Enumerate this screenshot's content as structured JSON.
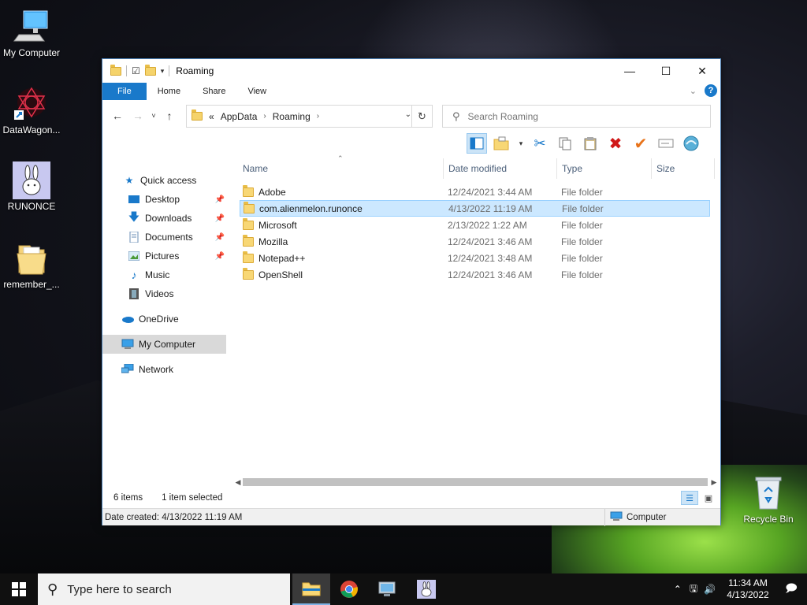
{
  "desktop": {
    "icons": [
      {
        "label": "My Computer"
      },
      {
        "label": "DataWagon..."
      },
      {
        "label": "RUNONCE"
      },
      {
        "label": "remember_..."
      },
      {
        "label": "Recycle Bin"
      }
    ]
  },
  "window": {
    "title": "Roaming",
    "ribbon_tabs": [
      "File",
      "Home",
      "Share",
      "View"
    ],
    "help_label": "?",
    "address": {
      "overflow": "«",
      "crumbs": [
        "AppData",
        "Roaming"
      ]
    },
    "search": {
      "placeholder": "Search Roaming"
    },
    "columns": [
      "Name",
      "Date modified",
      "Type",
      "Size"
    ],
    "navpane": {
      "quick_access": "Quick access",
      "items": [
        {
          "label": "Desktop"
        },
        {
          "label": "Downloads"
        },
        {
          "label": "Documents"
        },
        {
          "label": "Pictures"
        },
        {
          "label": "Music"
        },
        {
          "label": "Videos"
        }
      ],
      "onedrive": "OneDrive",
      "my_computer": "My Computer",
      "network": "Network"
    },
    "files": [
      {
        "name": "Adobe",
        "date": "12/24/2021 3:44 AM",
        "type": "File folder"
      },
      {
        "name": "com.alienmelon.runonce",
        "date": "4/13/2022 11:19 AM",
        "type": "File folder"
      },
      {
        "name": "Microsoft",
        "date": "2/13/2022 1:22 AM",
        "type": "File folder"
      },
      {
        "name": "Mozilla",
        "date": "12/24/2021 3:46 AM",
        "type": "File folder"
      },
      {
        "name": "Notepad++",
        "date": "12/24/2021 3:48 AM",
        "type": "File folder"
      },
      {
        "name": "OpenShell",
        "date": "12/24/2021 3:46 AM",
        "type": "File folder"
      }
    ],
    "status": {
      "count": "6 items",
      "selected": "1 item selected"
    },
    "info": {
      "created": "Date created: 4/13/2022 11:19 AM",
      "location": "Computer"
    }
  },
  "taskbar": {
    "search_placeholder": "Type here to search",
    "time": "11:34 AM",
    "date": "4/13/2022"
  },
  "colors": {
    "accent": "#1979ca",
    "selection": "#cce8ff",
    "folder": "#f8d775"
  }
}
